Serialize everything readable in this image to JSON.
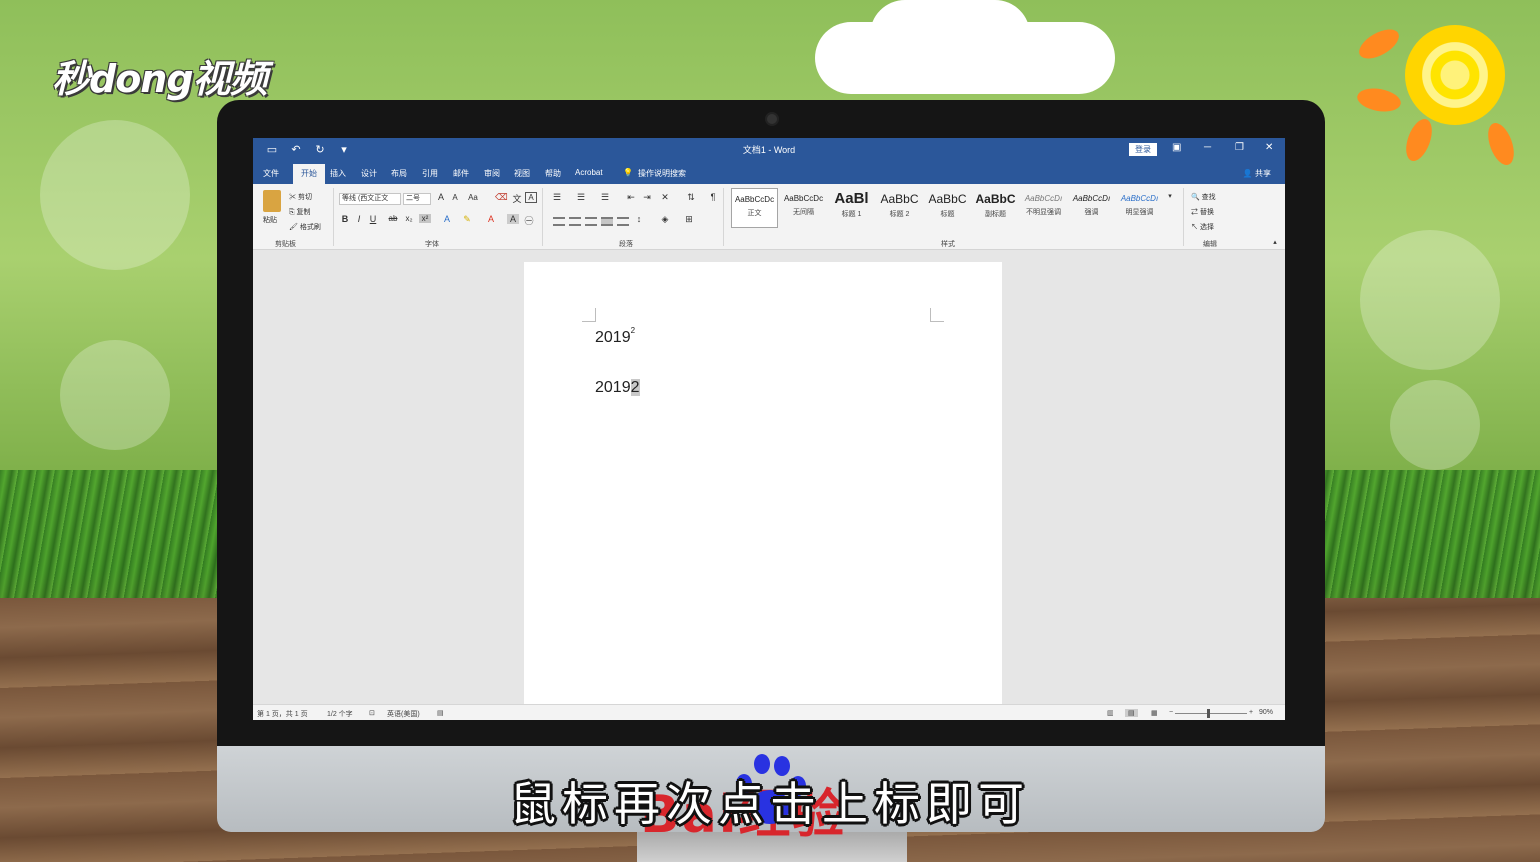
{
  "watermark": {
    "logo_text": "秒dong视频",
    "baidu_text": "Bai经验"
  },
  "subtitle": "鼠标再次点击上标即可",
  "word": {
    "title": "文档1 - Word",
    "login_label": "登录",
    "tabs": [
      "文件",
      "开始",
      "插入",
      "设计",
      "布局",
      "引用",
      "邮件",
      "审阅",
      "视图",
      "帮助",
      "Acrobat"
    ],
    "active_tab": "开始",
    "tell_me": "操作说明搜索",
    "share_label": "共享",
    "clipboard": {
      "paste": "粘贴",
      "cut": "剪切",
      "copy": "复制",
      "format_painter": "格式刷",
      "group": "剪贴板"
    },
    "font": {
      "name": "等线 (西文正文",
      "size": "二号",
      "group": "字体"
    },
    "paragraph": {
      "group": "段落"
    },
    "styles": {
      "group": "样式",
      "items": [
        {
          "sample": "AaBbCcDc",
          "name": "正文"
        },
        {
          "sample": "AaBbCcDc",
          "name": "无间隔"
        },
        {
          "sample": "AaBl",
          "name": "标题 1"
        },
        {
          "sample": "AaBbC",
          "name": "标题 2"
        },
        {
          "sample": "AaBbC",
          "name": "标题"
        },
        {
          "sample": "AaBbC",
          "name": "副标题"
        },
        {
          "sample": "AaBbCcDı",
          "name": "不明显强调"
        },
        {
          "sample": "AaBbCcDı",
          "name": "强调"
        },
        {
          "sample": "AaBbCcDı",
          "name": "明显强调"
        }
      ]
    },
    "editing": {
      "find": "查找",
      "replace": "替换",
      "select": "选择",
      "group": "编辑"
    },
    "document": {
      "line1_base": "2019",
      "line1_sup": "2",
      "line2_base": "2019",
      "line2_selected": "2"
    },
    "status": {
      "page": "第 1 页，共 1 页",
      "words": "1/2 个字",
      "language": "英语(美国)",
      "zoom": "90%"
    }
  }
}
